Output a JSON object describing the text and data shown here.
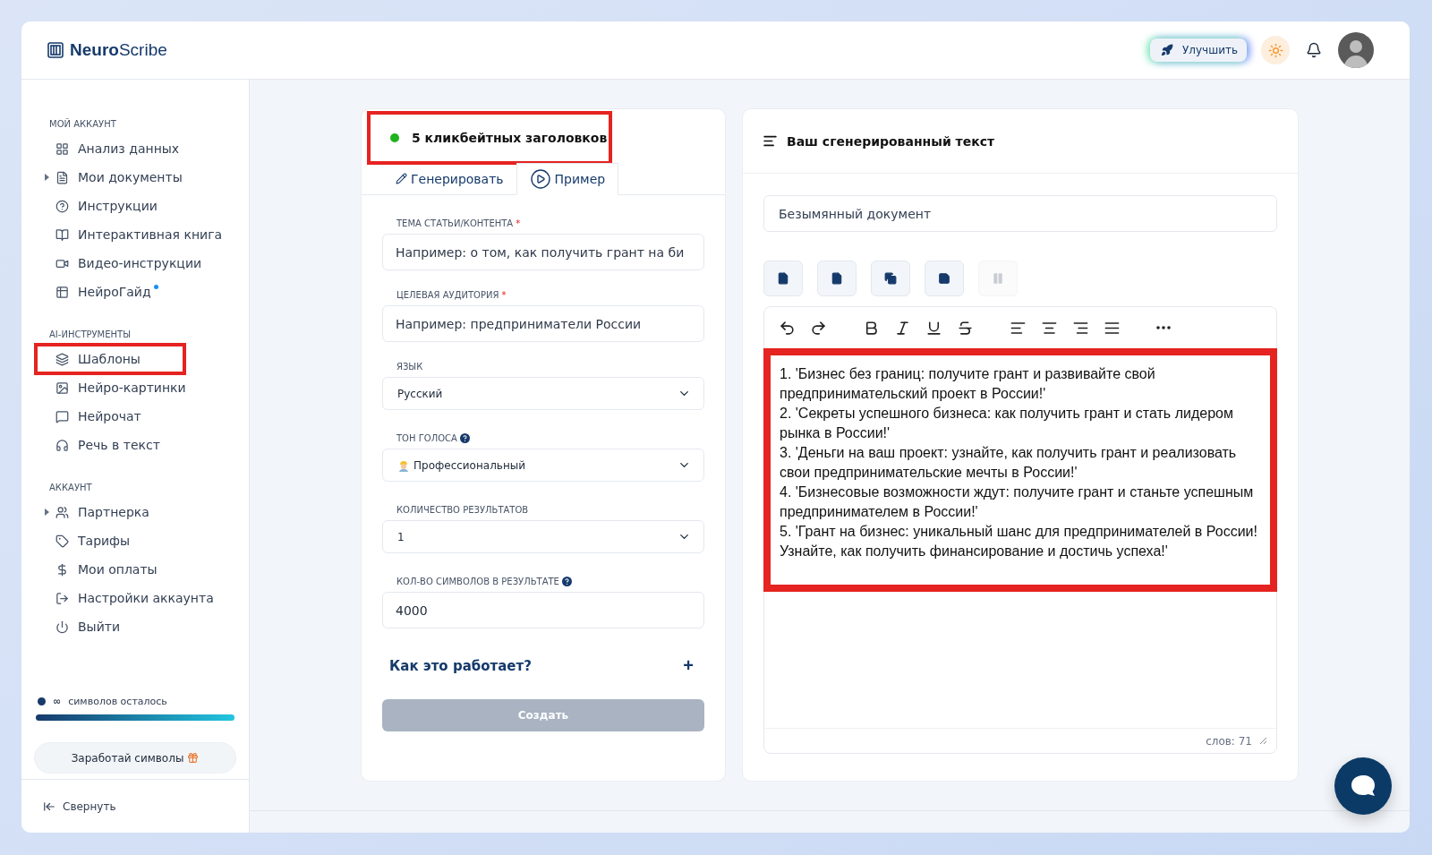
{
  "header": {
    "logo": "**Neuro**Scribe",
    "upgrade_button": "Улучшить"
  },
  "sidebar": {
    "sections": [
      {
        "title": "МОЙ АККАУНТ",
        "items": [
          {
            "label": "Анализ данных",
            "expandable": false,
            "badge_dot": false,
            "highlighted": false
          },
          {
            "label": "Мои документы",
            "expandable": true,
            "badge_dot": false,
            "highlighted": false
          },
          {
            "label": "Инструкции",
            "expandable": false,
            "badge_dot": false,
            "highlighted": false
          },
          {
            "label": "Интерактивная книга",
            "expandable": false,
            "badge_dot": false,
            "highlighted": false
          },
          {
            "label": "Видео-инструкции",
            "expandable": false,
            "badge_dot": false,
            "highlighted": false
          },
          {
            "label": "НейроГайд",
            "expandable": false,
            "badge_dot": true,
            "highlighted": false
          }
        ]
      },
      {
        "title": "AI-ИНСТРУМЕНТЫ",
        "items": [
          {
            "label": "Шаблоны",
            "expandable": false,
            "badge_dot": false,
            "highlighted": true
          },
          {
            "label": "Нейро-картинки",
            "expandable": false,
            "badge_dot": false,
            "highlighted": false
          },
          {
            "label": "Нейрочат",
            "expandable": false,
            "badge_dot": false,
            "highlighted": false
          },
          {
            "label": "Речь в текст",
            "expandable": false,
            "badge_dot": false,
            "highlighted": false
          }
        ]
      },
      {
        "title": "АККАУНТ",
        "items": [
          {
            "label": "Партнерка",
            "expandable": true,
            "badge_dot": false,
            "highlighted": false
          },
          {
            "label": "Тарифы",
            "expandable": false,
            "badge_dot": false,
            "highlighted": false
          },
          {
            "label": "Мои оплаты",
            "expandable": false,
            "badge_dot": false,
            "highlighted": false
          },
          {
            "label": "Настройки аккаунта",
            "expandable": false,
            "badge_dot": false,
            "highlighted": false
          },
          {
            "label": "Выйти",
            "expandable": false,
            "badge_dot": false,
            "highlighted": false
          }
        ]
      }
    ],
    "symbols": {
      "infinity": "∞",
      "label": "символов осталось",
      "level": 1
    },
    "earn_button": "Заработай символы",
    "collapse": "Свернуть"
  },
  "template": {
    "title": "5 кликбейтных заголовков",
    "highlighted": true,
    "tabs": [
      {
        "label": "Генерировать",
        "selected": false
      },
      {
        "label": "Пример",
        "selected": true
      }
    ],
    "fields": [
      {
        "kind": "input",
        "label": "ТЕМА СТАТЬИ/КОНТЕНТА",
        "required_mark": "*",
        "help": false,
        "placeholder": "Например: о том, как получить грант на би"
      },
      {
        "kind": "input",
        "label": "ЦЕЛЕВАЯ АУДИТОРИЯ",
        "required_mark": "*",
        "help": false,
        "placeholder": "Например: предприниматели России"
      },
      {
        "kind": "select",
        "label": "ЯЗЫК",
        "help": false,
        "value": "Русский",
        "emoji": false
      },
      {
        "kind": "select",
        "label": "ТОН ГОЛОСА",
        "help": true,
        "value": "Профессиональный",
        "emoji": true
      },
      {
        "kind": "select",
        "label": "КОЛИЧЕСТВО РЕЗУЛЬТАТОВ",
        "help": false,
        "value": "1",
        "emoji": false
      },
      {
        "kind": "input",
        "label": "КОЛ-ВО СИМВОЛОВ В РЕЗУЛЬТАТЕ",
        "help": true,
        "value": "4000"
      }
    ],
    "how_it_works": "Как это работает?",
    "expand_sign": "+",
    "create_button": "Создать",
    "create_disabled": true
  },
  "output": {
    "title": "Ваш сгенерированный текст",
    "document_name": "Безымянный документ",
    "doc_actions": [
      {
        "disabled": false
      },
      {
        "disabled": false
      },
      {
        "disabled": false
      },
      {
        "disabled": false
      },
      {
        "disabled": true
      }
    ],
    "highlighted": true,
    "lines": [
      "1. 'Бизнес без границ: получите грант и развивайте свой предпринимательский проект в России!'",
      "2. 'Секреты успешного бизнеса: как получить грант и стать лидером рынка в России!'",
      "3. 'Деньги на ваш проект: узнайте, как получить грант и реализовать свои предпринимательские мечты в России!'",
      "4. 'Бизнесовые возможности ждут: получите грант и станьте успешным предпринимателем в России!'",
      "5. 'Грант на бизнес: уникальный шанс для предпринимателей в России! Узнайте, как получить финансирование и достичь успеха!'"
    ],
    "word_count": "слов: 71"
  }
}
